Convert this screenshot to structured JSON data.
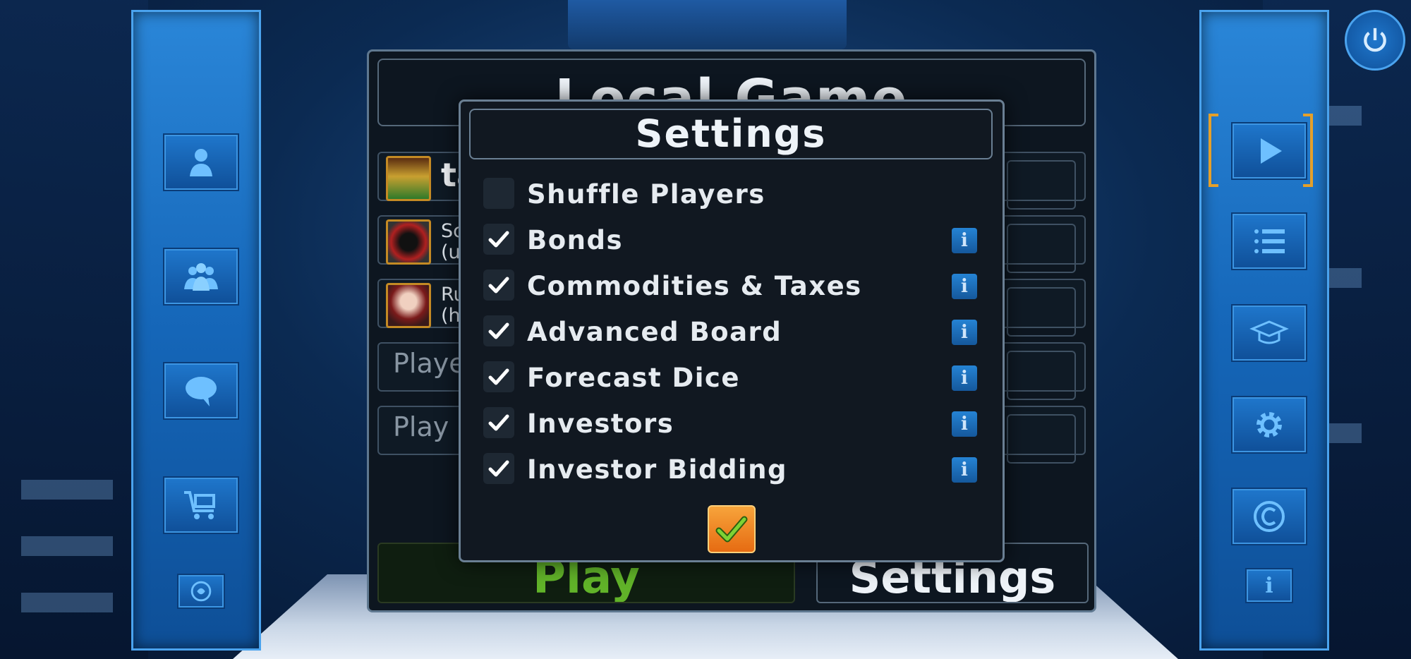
{
  "main": {
    "title": "Local Game",
    "players": [
      {
        "name": "ta"
      },
      {
        "line1": "Sc",
        "line2": "(u"
      },
      {
        "line1": "Ru",
        "line2": "(h"
      }
    ],
    "empty_slots": [
      "Playe",
      "Play"
    ],
    "play_label": "Play",
    "settings_label": "Settings"
  },
  "modal": {
    "title": "Settings",
    "options": [
      {
        "label": "Shuffle Players",
        "checked": false,
        "has_info": false
      },
      {
        "label": "Bonds",
        "checked": true,
        "has_info": true
      },
      {
        "label": "Commodities & Taxes",
        "checked": true,
        "has_info": true
      },
      {
        "label": "Advanced Board",
        "checked": true,
        "has_info": true
      },
      {
        "label": "Forecast Dice",
        "checked": true,
        "has_info": true
      },
      {
        "label": "Investors",
        "checked": true,
        "has_info": true
      },
      {
        "label": "Investor Bidding",
        "checked": true,
        "has_info": true
      }
    ],
    "info_glyph": "i"
  },
  "right_sidebar": {
    "info_glyph": "i"
  },
  "colors": {
    "accent_blue": "#1566b8",
    "play_green": "#61b329",
    "confirm_orange": "#f28a22",
    "bracket_gold": "#e5a02a"
  },
  "icons": {
    "left_sidebar": [
      "single-player-icon",
      "multiplayer-icon",
      "chat-icon",
      "shop-cart-icon",
      "logo-icon"
    ],
    "right_sidebar": [
      "play-icon",
      "list-icon",
      "tutorial-cap-icon",
      "gear-icon",
      "copyright-icon",
      "info-icon"
    ],
    "top_right": "power-icon"
  }
}
